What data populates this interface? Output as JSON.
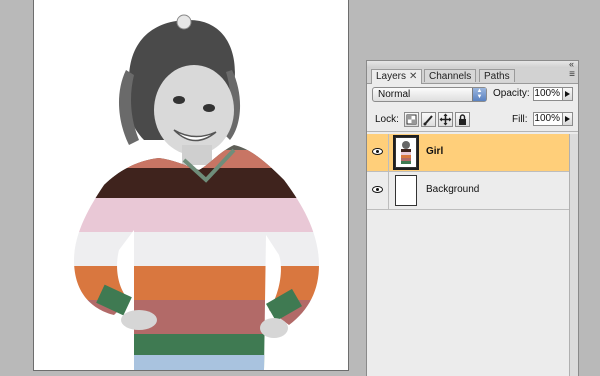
{
  "canvas": {
    "description_icon": "photo-girl-striped-sweater"
  },
  "panel": {
    "tabs": [
      {
        "label": "Layers",
        "close": "✕"
      },
      {
        "label": "Channels"
      },
      {
        "label": "Paths"
      }
    ],
    "menu_icon": "≡",
    "blend_mode": "Normal",
    "opacity_label": "Opacity:",
    "opacity_value": "100%",
    "lock_label": "Lock:",
    "fill_label": "Fill:",
    "fill_value": "100%",
    "lock_icons": [
      "lock-transparent-icon",
      "lock-image-icon",
      "lock-position-icon",
      "lock-all-icon"
    ],
    "layers": [
      {
        "name": "Girl",
        "selected": true,
        "visible": true
      },
      {
        "name": "Background",
        "selected": false,
        "visible": true
      }
    ]
  },
  "colors": {
    "selected_layer": "#ffcf7a",
    "panel_bg": "#ececec",
    "workspace_bg": "#b9b9b9"
  }
}
